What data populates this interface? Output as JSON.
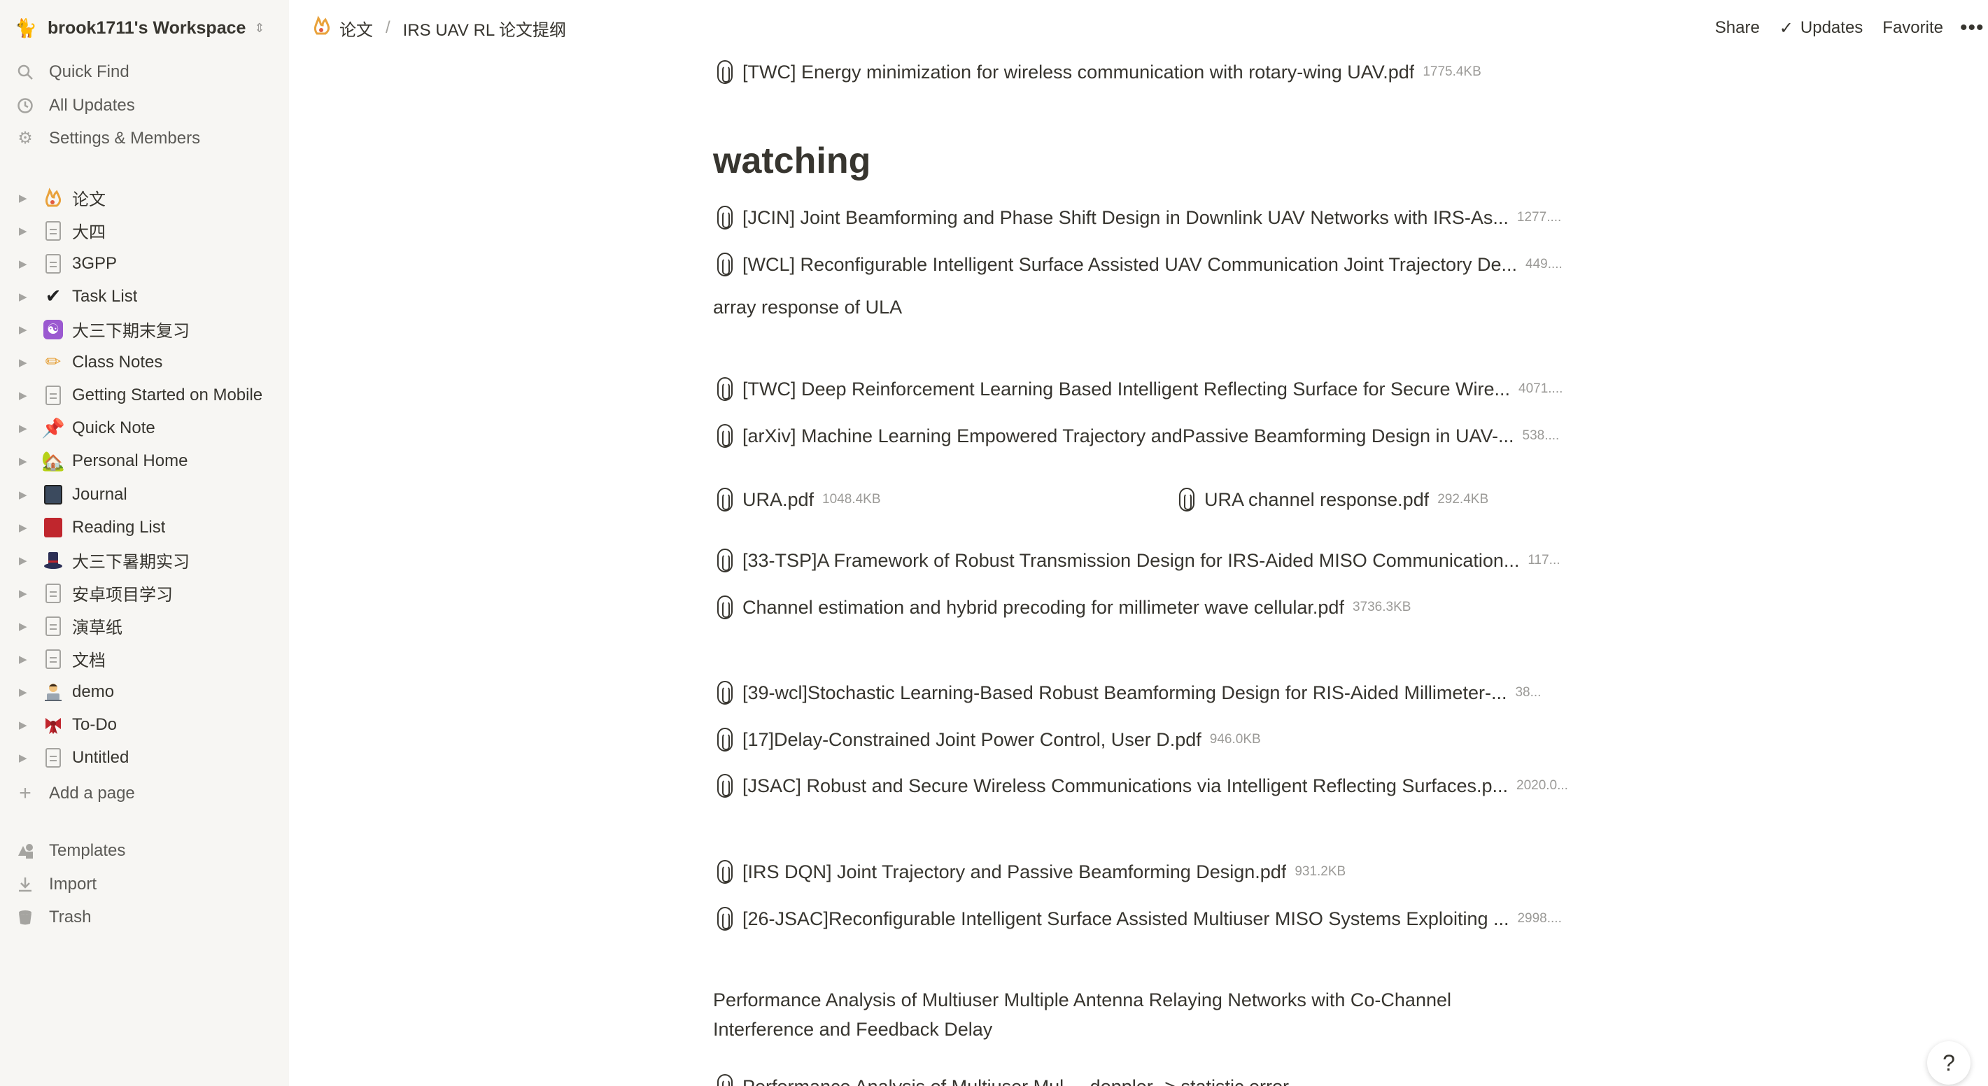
{
  "workspace": {
    "name": "brook1711's Workspace"
  },
  "sidebar": {
    "top_items": [
      {
        "label": "Quick Find",
        "icon": "search-icon"
      },
      {
        "label": "All Updates",
        "icon": "clock-icon"
      },
      {
        "label": "Settings & Members",
        "icon": "gear-icon"
      }
    ],
    "pages": [
      {
        "label": "论文",
        "icon": "🔥"
      },
      {
        "label": "大四",
        "icon": "doc"
      },
      {
        "label": "3GPP",
        "icon": "doc"
      },
      {
        "label": "Task List",
        "icon": "✔"
      },
      {
        "label": "大三下期末复习",
        "icon": "☯"
      },
      {
        "label": "Class Notes",
        "icon": "✏"
      },
      {
        "label": "Getting Started on Mobile",
        "icon": "doc"
      },
      {
        "label": "Quick Note",
        "icon": "📌"
      },
      {
        "label": "Personal Home",
        "icon": "🏡"
      },
      {
        "label": "Journal",
        "icon": "📓"
      },
      {
        "label": "Reading List",
        "icon": "📕"
      },
      {
        "label": "大三下暑期实习",
        "icon": "🎩"
      },
      {
        "label": "安卓项目学习",
        "icon": "doc"
      },
      {
        "label": "演草纸",
        "icon": "doc"
      },
      {
        "label": "文档",
        "icon": "doc"
      },
      {
        "label": "demo",
        "icon": "👨‍💻"
      },
      {
        "label": "To-Do",
        "icon": "🎀"
      },
      {
        "label": "Untitled",
        "icon": "doc"
      }
    ],
    "add_page": "Add a page",
    "bottom_items": [
      {
        "label": "Templates",
        "icon": "templates-icon"
      },
      {
        "label": "Import",
        "icon": "import-icon"
      },
      {
        "label": "Trash",
        "icon": "trash-icon"
      }
    ]
  },
  "topbar": {
    "breadcrumb_root": "论文",
    "breadcrumb_sep": "/",
    "breadcrumb_page": "IRS UAV RL 论文提纲",
    "share": "Share",
    "updates": "Updates",
    "favorite": "Favorite",
    "more": "•••"
  },
  "content": {
    "file_top": {
      "name": "[TWC] Energy minimization for wireless communication with rotary-wing UAV.pdf",
      "size": "1775.4KB"
    },
    "heading": "watching",
    "files_a": [
      {
        "name": "[JCIN] Joint Beamforming and Phase Shift Design in Downlink UAV Networks with IRS-As...",
        "size": "1277...."
      },
      {
        "name": "[WCL] Reconfigurable Intelligent Surface Assisted UAV Communication Joint Trajectory De...",
        "size": "449...."
      }
    ],
    "text_ula": "array response of ULA",
    "files_b": [
      {
        "name": "[TWC] Deep Reinforcement Learning Based Intelligent Reflecting Surface for Secure Wire...",
        "size": "4071...."
      },
      {
        "name": "[arXiv] Machine Learning Empowered Trajectory andPassive Beamforming Design in UAV-...",
        "size": "538...."
      }
    ],
    "file_ura": {
      "name": "URA.pdf",
      "size": "1048.4KB"
    },
    "file_ura_channel": {
      "name": "URA channel response.pdf",
      "size": "292.4KB"
    },
    "files_c": [
      {
        "name": "[33-TSP]A Framework of Robust Transmission Design for IRS-Aided MISO Communication...",
        "size": "117..."
      },
      {
        "name": "Channel estimation and hybrid precoding for millimeter wave cellular.pdf",
        "size": "3736.3KB"
      }
    ],
    "files_d": [
      {
        "name": "[39-wcl]Stochastic Learning-Based Robust Beamforming Design for RIS-Aided Millimeter-...",
        "size": "38..."
      },
      {
        "name": "[17]Delay-Constrained Joint Power Control, User D.pdf",
        "size": "946.0KB"
      },
      {
        "name": "[JSAC] Robust and Secure Wireless Communications via Intelligent Reflecting Surfaces.p...",
        "size": "2020.0..."
      }
    ],
    "files_e": [
      {
        "name": "[IRS DQN] Joint Trajectory and Passive Beamforming Design.pdf",
        "size": "931.2KB"
      },
      {
        "name": "[26-JSAC]Reconfigurable Intelligent Surface Assisted Multiuser MISO Systems Exploiting ...",
        "size": "2998...."
      }
    ],
    "paragraph_perf": "Performance Analysis of Multiuser Multiple Antenna Relaying Networks with Co-Channel Interference and Feedback Delay",
    "partial_bottom": "Performance Analysis of Multiuser Mul ... doppler -> statistic error"
  },
  "help": "?"
}
